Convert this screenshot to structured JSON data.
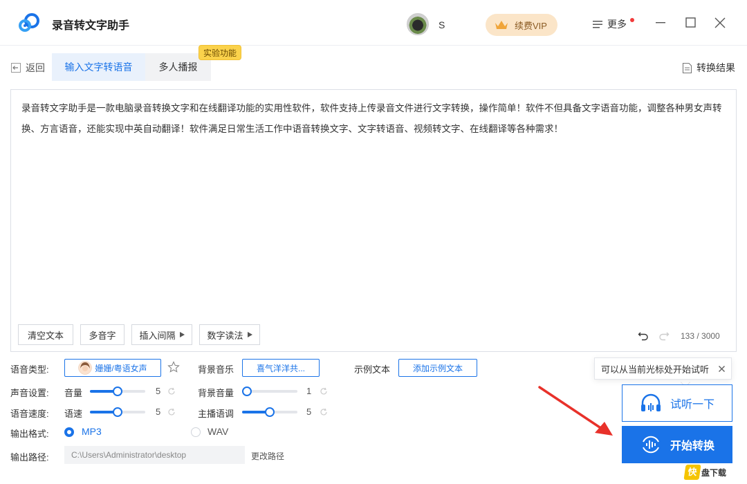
{
  "app": {
    "title": "录音转文字助手",
    "username": "S",
    "vip_label": "续费VIP",
    "more_label": "更多"
  },
  "colors": {
    "accent": "#1a73e8",
    "vip_bg": "#fbe5c8",
    "badge": "#fbd24b",
    "notify_dot": "#f23b3b"
  },
  "nav": {
    "back_label": "返回",
    "tabs": [
      {
        "label": "输入文字转语音",
        "active": true
      },
      {
        "label": "多人播报",
        "active": false
      }
    ],
    "experimental_badge": "实验功能",
    "result_label": "转换结果"
  },
  "editor": {
    "text": "录音转文字助手是一款电脑录音转换文字和在线翻译功能的实用性软件，软件支持上传录音文件进行文字转换，操作简单！软件不但具备文字语音功能，调整各种男女声转换、方言语音，还能实现中英自动翻译！软件满足日常生活工作中语音转换文字、文字转语音、视频转文字、在线翻译等各种需求！",
    "buttons": {
      "clear": "清空文本",
      "polyphone": "多音字",
      "insert_pause": "插入间隔",
      "number_reading": "数字读法"
    },
    "char_count": "133 / 3000"
  },
  "settings": {
    "voice_type_label": "语音类型:",
    "voice_name": "姗姗/粤语女声",
    "bg_music_label": "背景音乐",
    "bg_music_value": "喜气洋洋共...",
    "sample_text_label": "示例文本",
    "add_sample_label": "添加示例文本",
    "sound_setting_label": "声音设置:",
    "volume_label": "音量",
    "volume_value": "5",
    "volume_level": 0.5,
    "bg_volume_label": "背景音量",
    "bg_volume_value": "1",
    "bg_volume_level": 0.0,
    "speed_section_label": "语音速度:",
    "speed_label": "语速",
    "speed_value": "5",
    "speed_level": 0.5,
    "pitch_label": "主播语调",
    "pitch_value": "5",
    "pitch_level": 0.5,
    "format_label": "输出格式:",
    "format_options": [
      {
        "label": "MP3",
        "selected": true
      },
      {
        "label": "WAV",
        "selected": false
      }
    ],
    "path_label": "输出路径:",
    "path_value": "C:\\Users\\Administrator\\desktop",
    "change_path_label": "更改路径"
  },
  "actions": {
    "tooltip": "可以从当前光标处开始试听",
    "listen_label": "试听一下",
    "convert_label": "开始转换"
  },
  "watermark": {
    "char": "快",
    "text": "盘下载"
  }
}
